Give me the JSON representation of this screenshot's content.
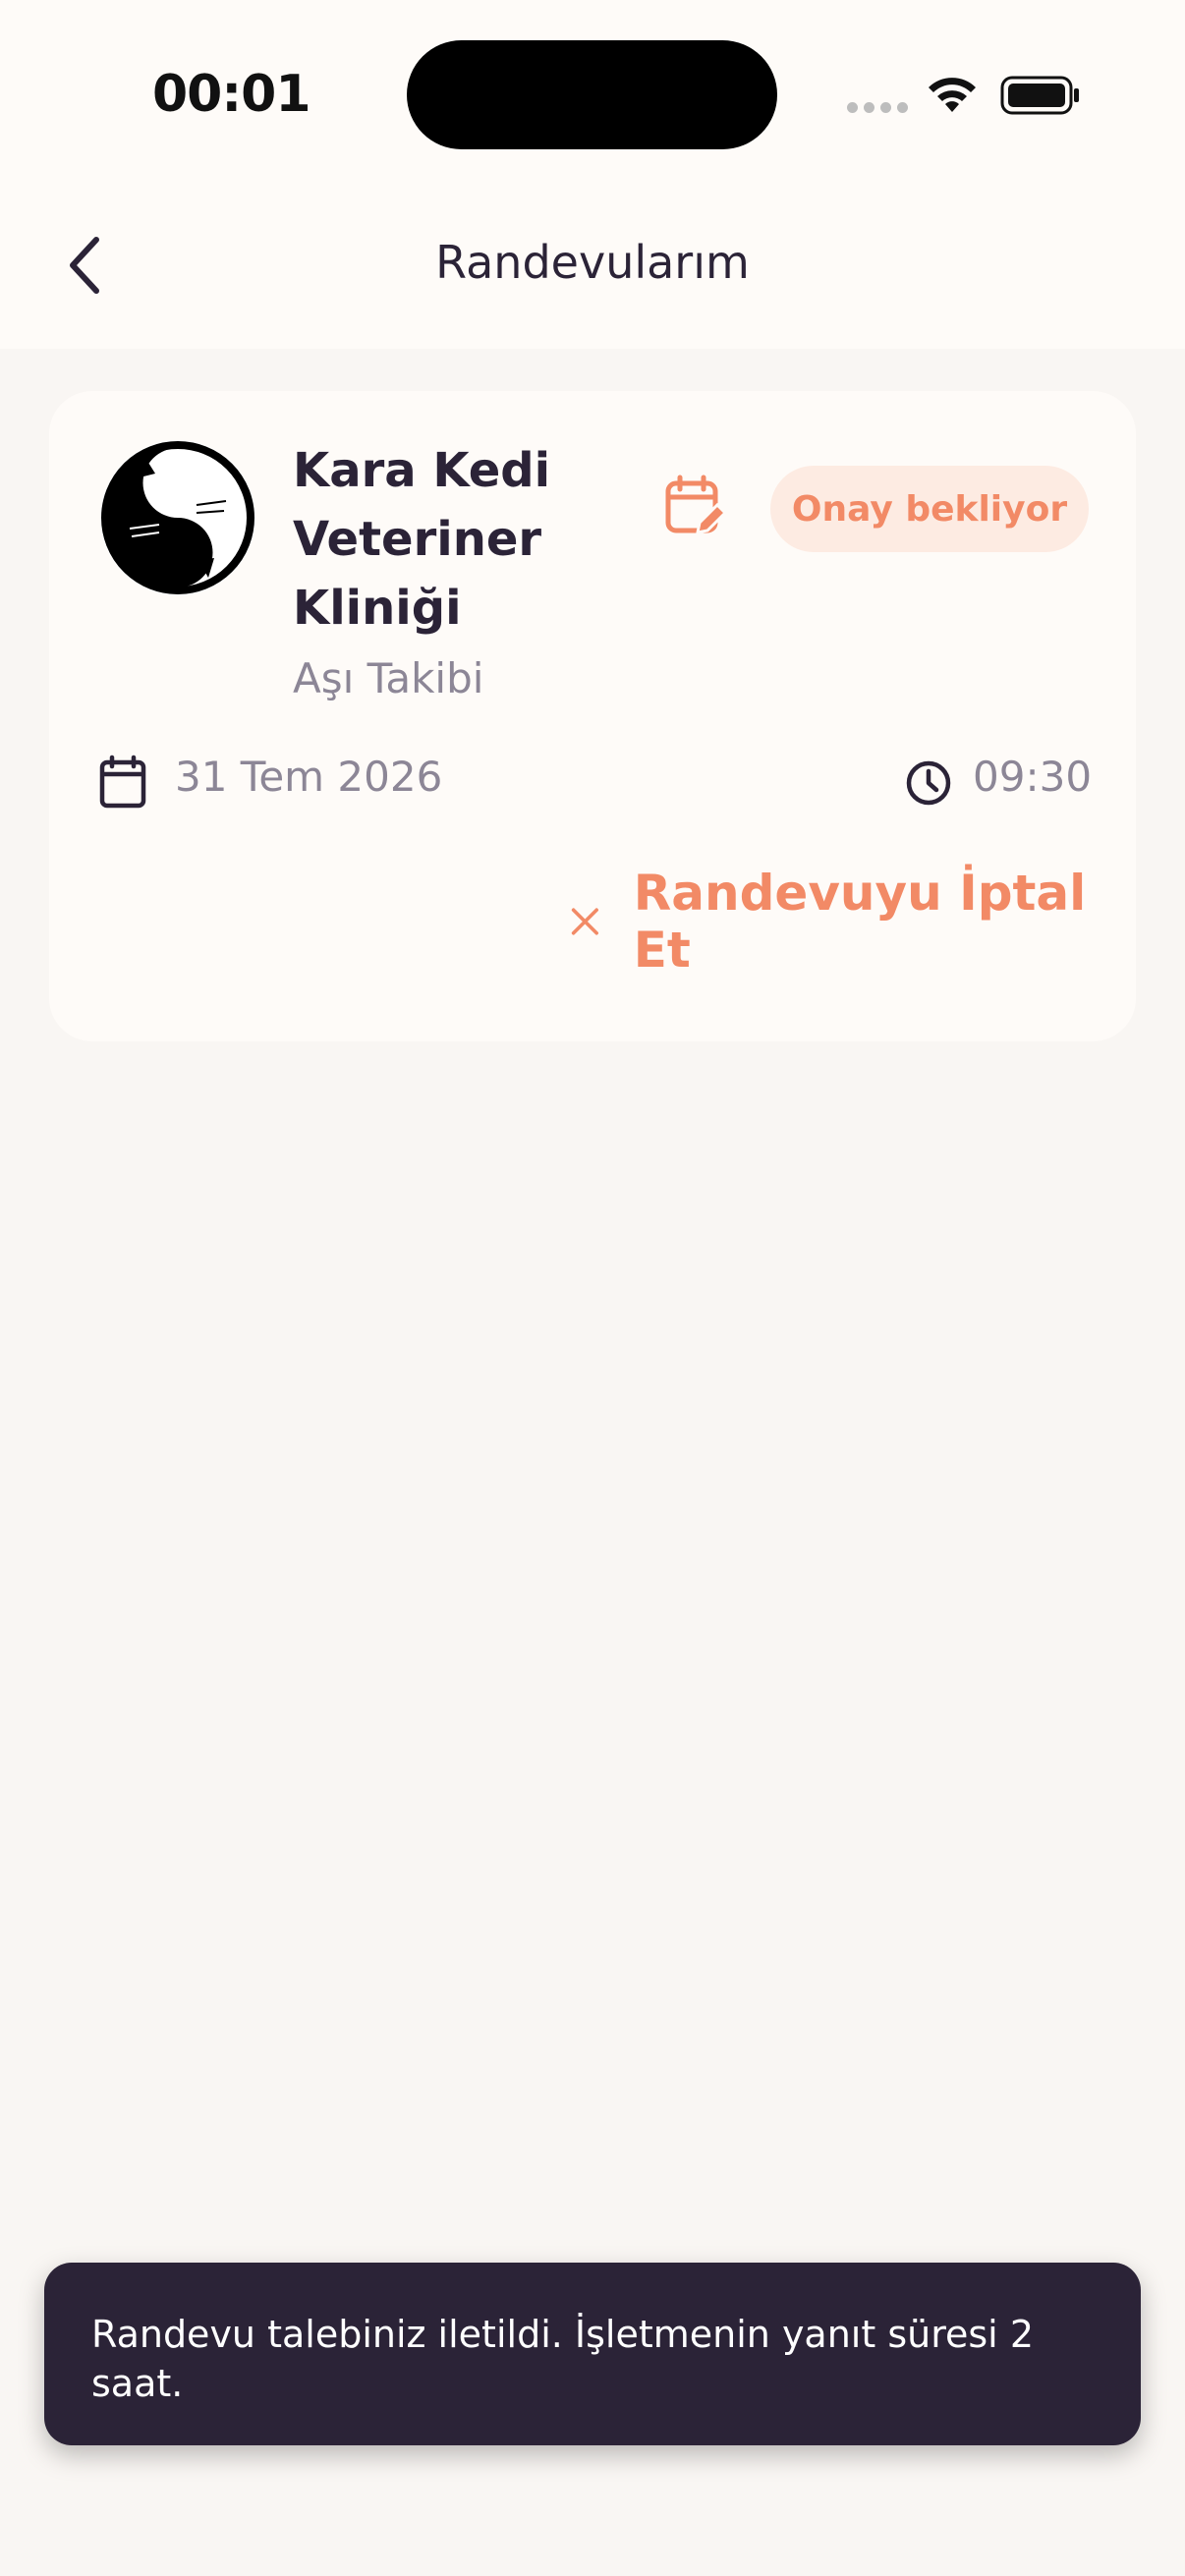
{
  "status_bar": {
    "time": "00:01",
    "icons": [
      "cellular-signal-icon",
      "wifi-icon",
      "battery-icon"
    ]
  },
  "header": {
    "title": "Randevularım",
    "back_icon": "chevron-left-icon"
  },
  "appointment": {
    "clinic_name": "Kara Kedi Veteriner Kliniği",
    "service": "Aşı Takibi",
    "status": "Onay bekliyor",
    "date": "31 Tem 2026",
    "time": "09:30",
    "cancel_label": "Randevuyu İptal Et",
    "logo_icon": "yin-yang-cats-logo",
    "edit_icon": "calendar-edit-icon",
    "date_icon": "calendar-icon",
    "time_icon": "clock-icon",
    "cancel_icon": "close-icon"
  },
  "snackbar": {
    "message": "Randevu talebiniz iletildi. İşletmenin yanıt süresi 2 saat."
  },
  "colors": {
    "background": "#f9f6f3",
    "card": "#fefbf8",
    "accent": "#f28a66",
    "badge_bg": "#fdebe2",
    "text_dark": "#2b2337",
    "text_muted": "#8c8696",
    "snackbar_bg": "#2b2337"
  }
}
